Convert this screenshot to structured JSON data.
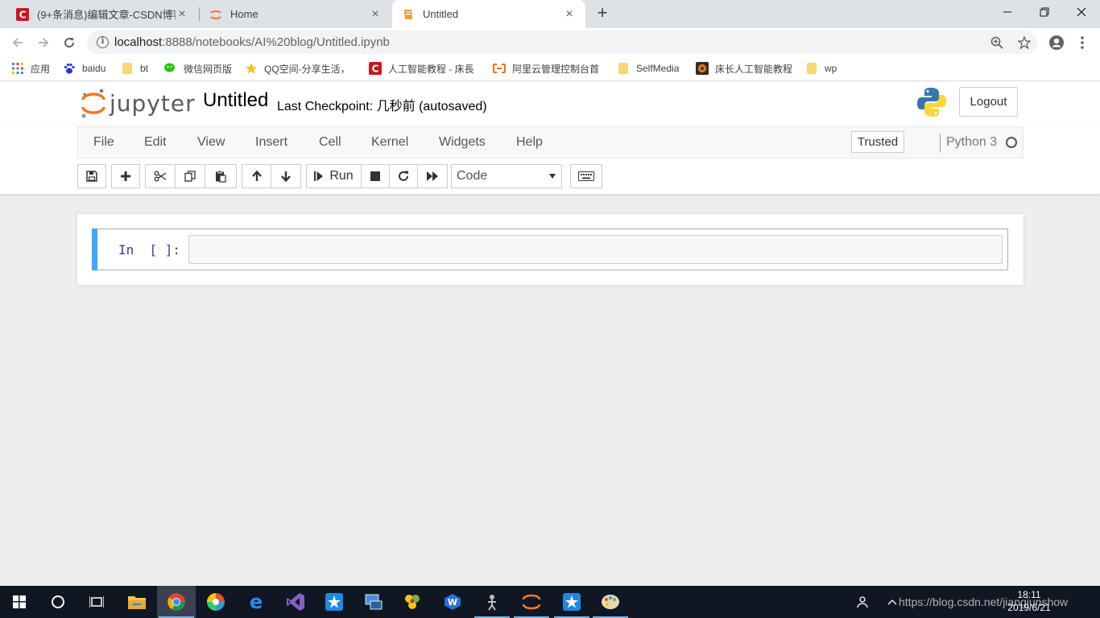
{
  "browser": {
    "tabs": [
      {
        "label": "(9+条消息)编辑文章-CSDN博客",
        "icon": "csdn-icon"
      },
      {
        "label": "Home",
        "icon": "jupyter-icon"
      },
      {
        "label": "Untitled",
        "icon": "notebook-icon"
      }
    ],
    "url_host": "localhost",
    "url_path": ":8888/notebooks/AI%20blog/Untitled.ipynb"
  },
  "bookmarks": [
    {
      "label": "应用",
      "icon": "apps-grid-icon"
    },
    {
      "label": "baidu",
      "icon": "baidu-paw-icon"
    },
    {
      "label": "bt",
      "icon": "folder-icon"
    },
    {
      "label": "微信网页版",
      "icon": "wechat-icon"
    },
    {
      "label": "QQ空间-分享生活，",
      "icon": "qzone-star-icon"
    },
    {
      "label": "人工智能教程 - 床長",
      "icon": "csdn-icon"
    },
    {
      "label": "阿里云管理控制台首",
      "icon": "aliyun-icon"
    },
    {
      "label": "SelfMedia",
      "icon": "folder-icon"
    },
    {
      "label": "床长人工智能教程",
      "icon": "site-icon"
    },
    {
      "label": "wp",
      "icon": "folder-icon"
    }
  ],
  "jupyter": {
    "logo_text": "jupyter",
    "notebook_name": "Untitled",
    "checkpoint": "Last Checkpoint: 几秒前   (autosaved)",
    "logout_label": "Logout",
    "menu": [
      "File",
      "Edit",
      "View",
      "Insert",
      "Cell",
      "Kernel",
      "Widgets",
      "Help"
    ],
    "trusted_label": "Trusted",
    "kernel_name": "Python 3",
    "run_label": "Run",
    "cell_type": "Code",
    "prompt": "In  [ ]:",
    "accent_color": "#42a5f5"
  },
  "taskbar": {
    "time": "18:11",
    "date": "2019/6/21",
    "watermark": "https://blog.csdn.net/jiangjunshow"
  }
}
